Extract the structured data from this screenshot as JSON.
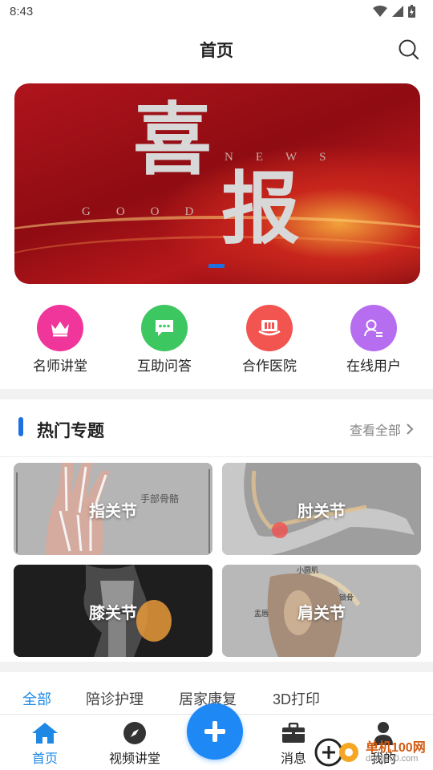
{
  "status_bar": {
    "time": "8:43"
  },
  "header": {
    "title": "首页",
    "search_icon": "search-icon"
  },
  "banner": {
    "title_char_1": "喜",
    "title_char_2": "报",
    "word_news": "NEWS",
    "word_good": "GOOD",
    "colors": {
      "primary": "#b0141c",
      "glow": "#f2a23a",
      "indicator": "#1e6fe0"
    }
  },
  "quick_nav": [
    {
      "label": "名师讲堂",
      "icon": "crown-icon",
      "color": "#f0359b"
    },
    {
      "label": "互助问答",
      "icon": "chat-bubble-icon",
      "color": "#3cc760"
    },
    {
      "label": "合作医院",
      "icon": "hospital-icon",
      "color": "#f2544f"
    },
    {
      "label": "在线用户",
      "icon": "user-list-icon",
      "color": "#b66df0"
    }
  ],
  "topics": {
    "title": "热门专题",
    "more_label": "查看全部",
    "cards": [
      {
        "label": "指关节"
      },
      {
        "label": "肘关节"
      },
      {
        "label": "膝关节"
      },
      {
        "label": "肩关节"
      }
    ],
    "card_inner_text": {
      "hand": "手部骨骼",
      "shoulder_top": "小圆肌",
      "shoulder_left": "盂唇",
      "shoulder_right": "锁骨"
    }
  },
  "tabs": {
    "items": [
      "全部",
      "陪诊护理",
      "居家康复",
      "3D打印"
    ],
    "active": "全部",
    "accent": "#1e88e5"
  },
  "bottom_nav": {
    "items": [
      {
        "label": "首页",
        "icon": "home-icon",
        "active": true
      },
      {
        "label": "视频讲堂",
        "icon": "compass-icon",
        "active": false
      },
      {
        "label": "消息",
        "icon": "briefcase-icon",
        "active": false
      },
      {
        "label": "我的",
        "icon": "person-icon",
        "active": false
      }
    ],
    "fab_icon": "plus-icon"
  },
  "watermark": {
    "text": "单机100网",
    "sub": "danji100.com"
  }
}
